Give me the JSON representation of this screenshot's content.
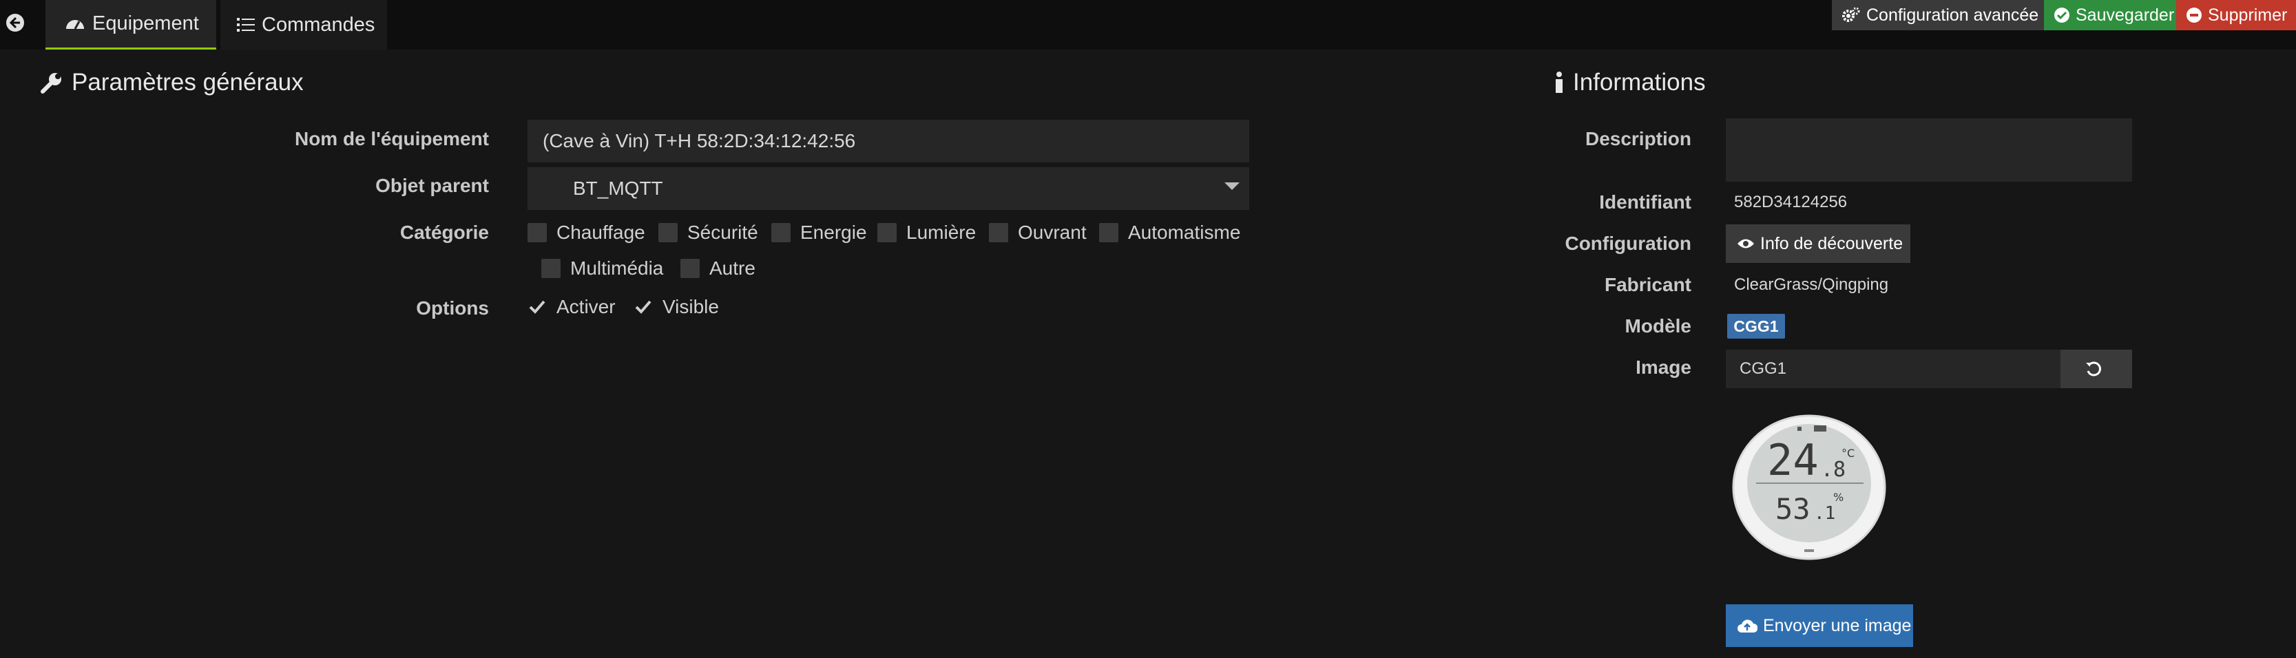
{
  "tabs": {
    "equipment_label": "Equipement",
    "commands_label": "Commandes"
  },
  "actions": {
    "advanced_label": "Configuration avancée",
    "save_label": "Sauvegarder",
    "delete_label": "Supprimer"
  },
  "general": {
    "title": "Paramètres généraux",
    "name_label": "Nom de l'équipement",
    "name_value": "(Cave à Vin) T+H 58:2D:34:12:42:56",
    "parent_label": "Objet parent",
    "parent_value": "BT_MQTT",
    "category_label": "Catégorie",
    "categories": [
      "Chauffage",
      "Sécurité",
      "Energie",
      "Lumière",
      "Ouvrant",
      "Automatisme",
      "Multimédia",
      "Autre"
    ],
    "options_label": "Options",
    "options": [
      {
        "label": "Activer",
        "checked": true
      },
      {
        "label": "Visible",
        "checked": true
      }
    ]
  },
  "info": {
    "title": "Informations",
    "description_label": "Description",
    "description_value": "",
    "identifier_label": "Identifiant",
    "identifier_value": "582D34124256",
    "configuration_label": "Configuration",
    "discovery_button": "Info de découverte",
    "manufacturer_label": "Fabricant",
    "manufacturer_value": "ClearGrass/Qingping",
    "model_label": "Modèle",
    "model_value": "CGG1",
    "image_label": "Image",
    "image_value": "CGG1",
    "upload_button": "Envoyer une image",
    "device_display": {
      "temperature_int": "24",
      "temperature_dec": ".8",
      "temperature_unit": "°C",
      "humidity_int": "53",
      "humidity_dec": ".1",
      "humidity_unit": "%"
    }
  },
  "colors": {
    "accent_green": "#94ca02",
    "save_green": "#2f8f3e",
    "delete_red": "#c0392b",
    "badge_blue": "#3a6ea8",
    "upload_blue": "#2f6fb0"
  }
}
